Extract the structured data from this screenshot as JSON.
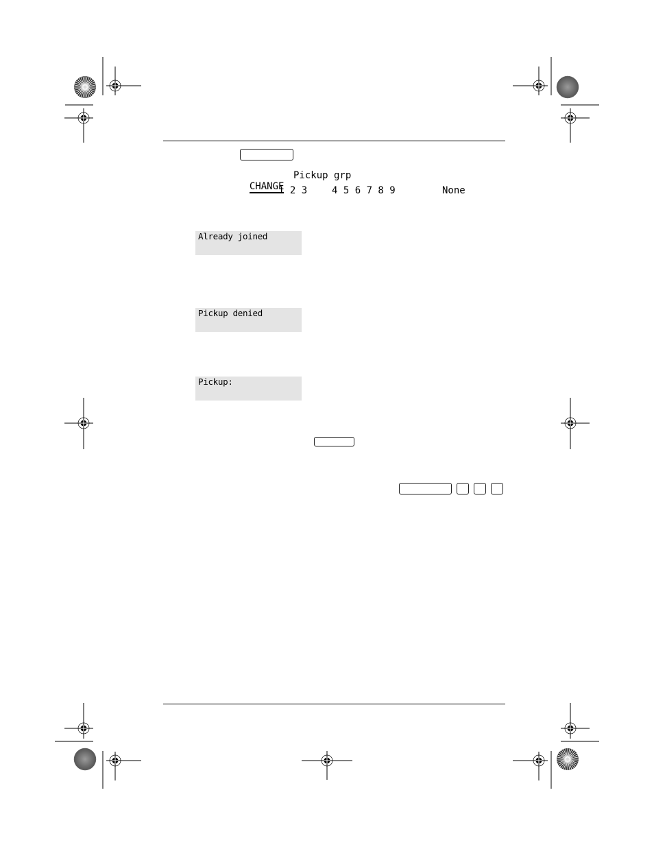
{
  "header_key": {
    "label": ""
  },
  "display_options": {
    "change_label": "CHANGE",
    "title": "Pickup grp",
    "options_1": "1 2 3",
    "options_2": "4 5 6 7 8 9",
    "options_3": "None"
  },
  "displays": [
    {
      "text": "Already joined"
    },
    {
      "text": "Pickup denied"
    },
    {
      "text": "Pickup:"
    }
  ],
  "keys": {
    "mid_key": {
      "label": ""
    },
    "feature_key": {
      "label": ""
    },
    "digit_keys": [
      "",
      "",
      ""
    ]
  },
  "registration_marks": {
    "crosshair_icon": "crosshair-target-icon",
    "starburst_icon": "starburst-registration-icon"
  }
}
